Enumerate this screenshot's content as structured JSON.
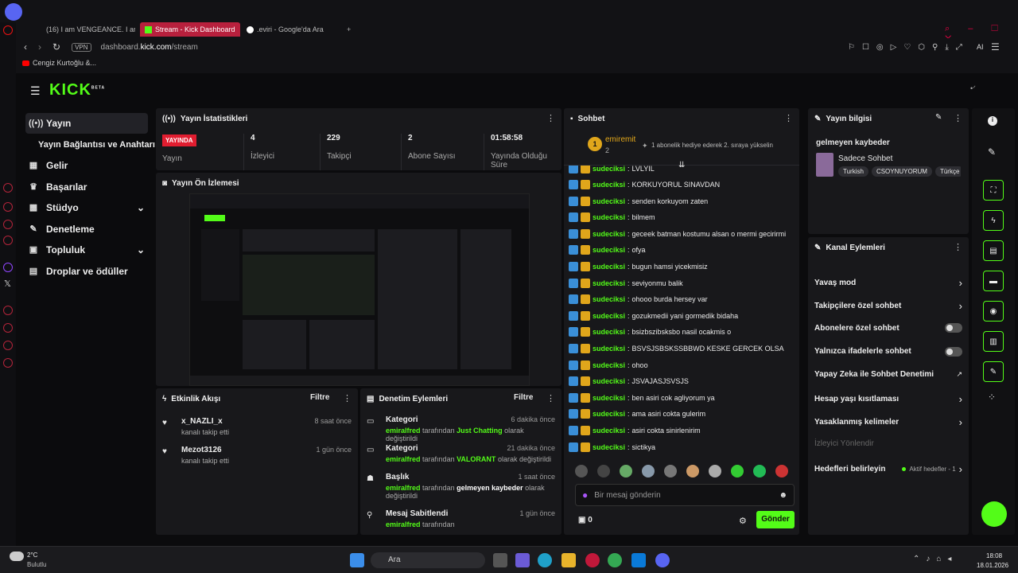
{
  "browser": {
    "tabs": [
      "(16) I am VENGEANCE. I am",
      "Stream - Kick Dashboard",
      ".eviri - Google'da Ara"
    ],
    "url_prefix": "dashboard.",
    "url_domain": "kick.com",
    "url_path": "/stream",
    "vpn": "VPN",
    "bookmark": "Cengiz Kurtoğlu &...",
    "ai": "AI"
  },
  "logo": "KICK",
  "logo_beta": "BETA",
  "nav": {
    "items": [
      {
        "label": "Yayın",
        "icon": "broadcast-icon"
      },
      {
        "label": "Yayın Bağlantısı ve Anahtarı",
        "icon": ""
      },
      {
        "label": "Gelir",
        "icon": "revenue-icon"
      },
      {
        "label": "Başarılar",
        "icon": "trophy-icon"
      },
      {
        "label": "Stüdyo",
        "icon": "studio-icon"
      },
      {
        "label": "Denetleme",
        "icon": "wrench-icon"
      },
      {
        "label": "Topluluk",
        "icon": "community-icon"
      },
      {
        "label": "Droplar ve ödüller",
        "icon": "gift-icon"
      }
    ]
  },
  "stats": {
    "title": "Yayın İstatistikleri",
    "live_badge": "YAYINDA",
    "items": [
      {
        "value": "",
        "label": "Yayın"
      },
      {
        "value": "4",
        "label": "İzleyici"
      },
      {
        "value": "229",
        "label": "Takipçi"
      },
      {
        "value": "2",
        "label": "Abone Sayısı"
      },
      {
        "value": "01:58:58",
        "label": "Yayında Olduğu Süre"
      }
    ]
  },
  "preview": {
    "title": "Yayın Ön İzlemesi"
  },
  "activity": {
    "title": "Etkinlik Akışı",
    "filter": "Filtre",
    "items": [
      {
        "name": "x_NAZLI_x",
        "action": "kanalı takip etti",
        "time": "8 saat önce"
      },
      {
        "name": "Mezot3126",
        "action": "kanalı takip etti",
        "time": "1 gün önce"
      }
    ]
  },
  "moderation": {
    "title": "Denetim Eylemleri",
    "filter": "Filtre",
    "items": [
      {
        "title": "Kategori",
        "user": "emiralfred",
        "mid": "tarafından",
        "val": "Just Chatting",
        "end": "olarak değiştirildi",
        "time": "6 dakika önce"
      },
      {
        "title": "Kategori",
        "user": "emiralfred",
        "mid": "tarafından",
        "val": "VALORANT",
        "end": "olarak değiştirildi",
        "time": "21 dakika önce"
      },
      {
        "title": "Başlık",
        "user": "emiralfred",
        "mid": "tarafından",
        "val": "gelmeyen kaybeder",
        "end": "olarak değiştirildi",
        "time": "1 saat önce"
      },
      {
        "title": "Mesaj Sabitlendi",
        "user": "emiralfred",
        "mid": "tarafından",
        "val": "",
        "end": "",
        "time": "1 gün önce"
      }
    ]
  },
  "chat": {
    "title": "Sohbet",
    "pinned_user": "emiremit",
    "pinned_count": "2",
    "pinned_msg": "1 abonelik hediye ederek 2. sıraya yükselin",
    "rank": "1",
    "partial_top": "LVLYIL",
    "messages_user": "sudeciksi",
    "messages": [
      "KORKUYORUL SINAVDAN",
      "senden korkuyom zaten",
      "bilmem",
      "geceek batman kostumu alsan o mermi gecirirmi",
      "ofya",
      "bugun hamsi yicekmisiz",
      "seviyonmu balik",
      "ohooo burda hersey var",
      "gozukmedii yani gormedik bidaha",
      "bsizbszibsksbo nasil ocakmis o",
      "BSVSJSBSKSSBBWD KESKE GERCEK OLSA",
      "ohoo",
      "JSVAJASJSVSJS",
      "ben asiri cok agliyorum ya",
      "ama asiri cokta gulerim",
      "asiri cokta sinirlenirim",
      "sictikya"
    ],
    "placeholder": "Bir mesaj gönderin",
    "send": "Gönder",
    "points": "0"
  },
  "info": {
    "title": "Yayın bilgisi",
    "stream_title": "gelmeyen kaybeder",
    "category": "Sadece Sohbet",
    "tags": [
      "Turkish",
      "CSOYNUYORUM",
      "Türkçe"
    ]
  },
  "channel_actions": {
    "title": "Kanal Eylemleri",
    "items": [
      {
        "label": "Yavaş mod",
        "kind": "chevron"
      },
      {
        "label": "Takipçilere özel sohbet",
        "kind": "chevron"
      },
      {
        "label": "Abonelere özel sohbet",
        "kind": "toggle"
      },
      {
        "label": "Yalnızca ifadelerle sohbet",
        "kind": "toggle"
      },
      {
        "label": "Yapay Zeka ile Sohbet Denetimi",
        "kind": "external"
      },
      {
        "label": "Hesap yaşı kısıtlaması",
        "kind": "chevron"
      },
      {
        "label": "Yasaklanmış kelimeler",
        "kind": "chevron"
      },
      {
        "label": "İzleyici Yönlendir",
        "kind": "disabled"
      },
      {
        "label": "Hedefleri belirleyin",
        "kind": "chevron"
      }
    ],
    "goals_badge": "Aktif hedefler - 1"
  },
  "taskbar": {
    "weather_temp": "2°C",
    "weather_desc": "Bulutlu",
    "search": "Ara",
    "time": "18:08",
    "date": "18.01.2026"
  }
}
